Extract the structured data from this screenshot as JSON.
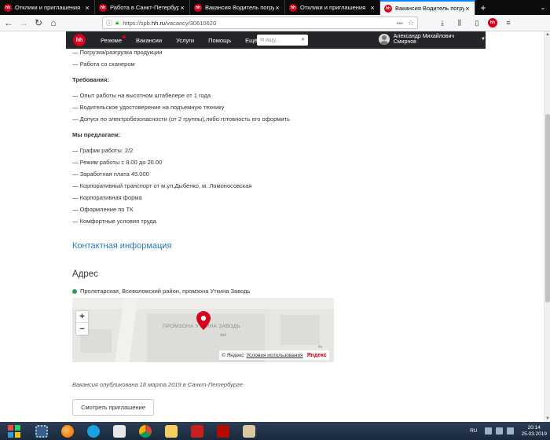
{
  "browser": {
    "tabs": [
      {
        "label": "Отклики и приглашения",
        "active": false
      },
      {
        "label": "Работа в Санкт-Петербурге",
        "active": false
      },
      {
        "label": "Вакансия Водитель погрузчика",
        "active": false
      },
      {
        "label": "Отклики и приглашения",
        "active": false
      },
      {
        "label": "Вакансия Водитель погрузчика",
        "active": true
      }
    ],
    "favicon_text": "hh",
    "new_tab": "+",
    "url_prefix": "https://spb.",
    "url_domain": "hh.ru",
    "url_path": "/vacancy/30610620",
    "url_dots": "•••",
    "ext_badge": "hh"
  },
  "hh_header": {
    "logo": "hh",
    "nav": [
      "Резюме",
      "Вакансии",
      "Услуги",
      "Помощь",
      "Ещё..."
    ],
    "search_placeholder": "Я ищу...",
    "user_name": "Александр Михайлович Смирнов"
  },
  "vacancy": {
    "duties_tail": [
      "— Погрузка/разгрузка продукции",
      "— Работа со сканером"
    ],
    "requirements_title": "Требования:",
    "requirements": [
      "— Опыт работы на высотном штабелере от 1 года",
      "— Водительское удостоверение на подъемную технику",
      "— Допуск по электробезопасности (от 2 группы),либо готовность его оформить"
    ],
    "offer_title": "Мы предлагаем:",
    "offer": [
      "— График работы: 2/2",
      "— Режим работы с 8.00 до 20.00",
      "— Заработная плата 45.000",
      "— Корпоративный транспорт от м.ул.Дыбенко, м. Ломоносовская",
      "— Корпоративная форма",
      "— Оформление по ТК",
      "— Комфортные условия труда."
    ],
    "contact_link": "Контактная информация",
    "address_title": "Адрес",
    "address": "Пролетарская, Всеволожский район, промзона Уткина Заводь",
    "map": {
      "zone_label": "ПРОМЗОНА УТКИНА ЗАВОДЬ",
      "sub_label": "4к4",
      "corner_label": "4к",
      "zoom_in": "+",
      "zoom_out": "−",
      "copyright": "© Яндекс",
      "terms": "Условия использования",
      "brand": "Яндекс"
    },
    "published": "Вакансия опубликована 18 марта 2019 в Санкт-Петербурге",
    "invite_button": "Смотреть приглашение"
  },
  "taskbar": {
    "lang": "RU",
    "time": "20:14",
    "date": "25.03.2019"
  },
  "colors": {
    "hh_red": "#d6001c",
    "link_blue": "#2b7bb9",
    "hh_dark": "#232529"
  }
}
